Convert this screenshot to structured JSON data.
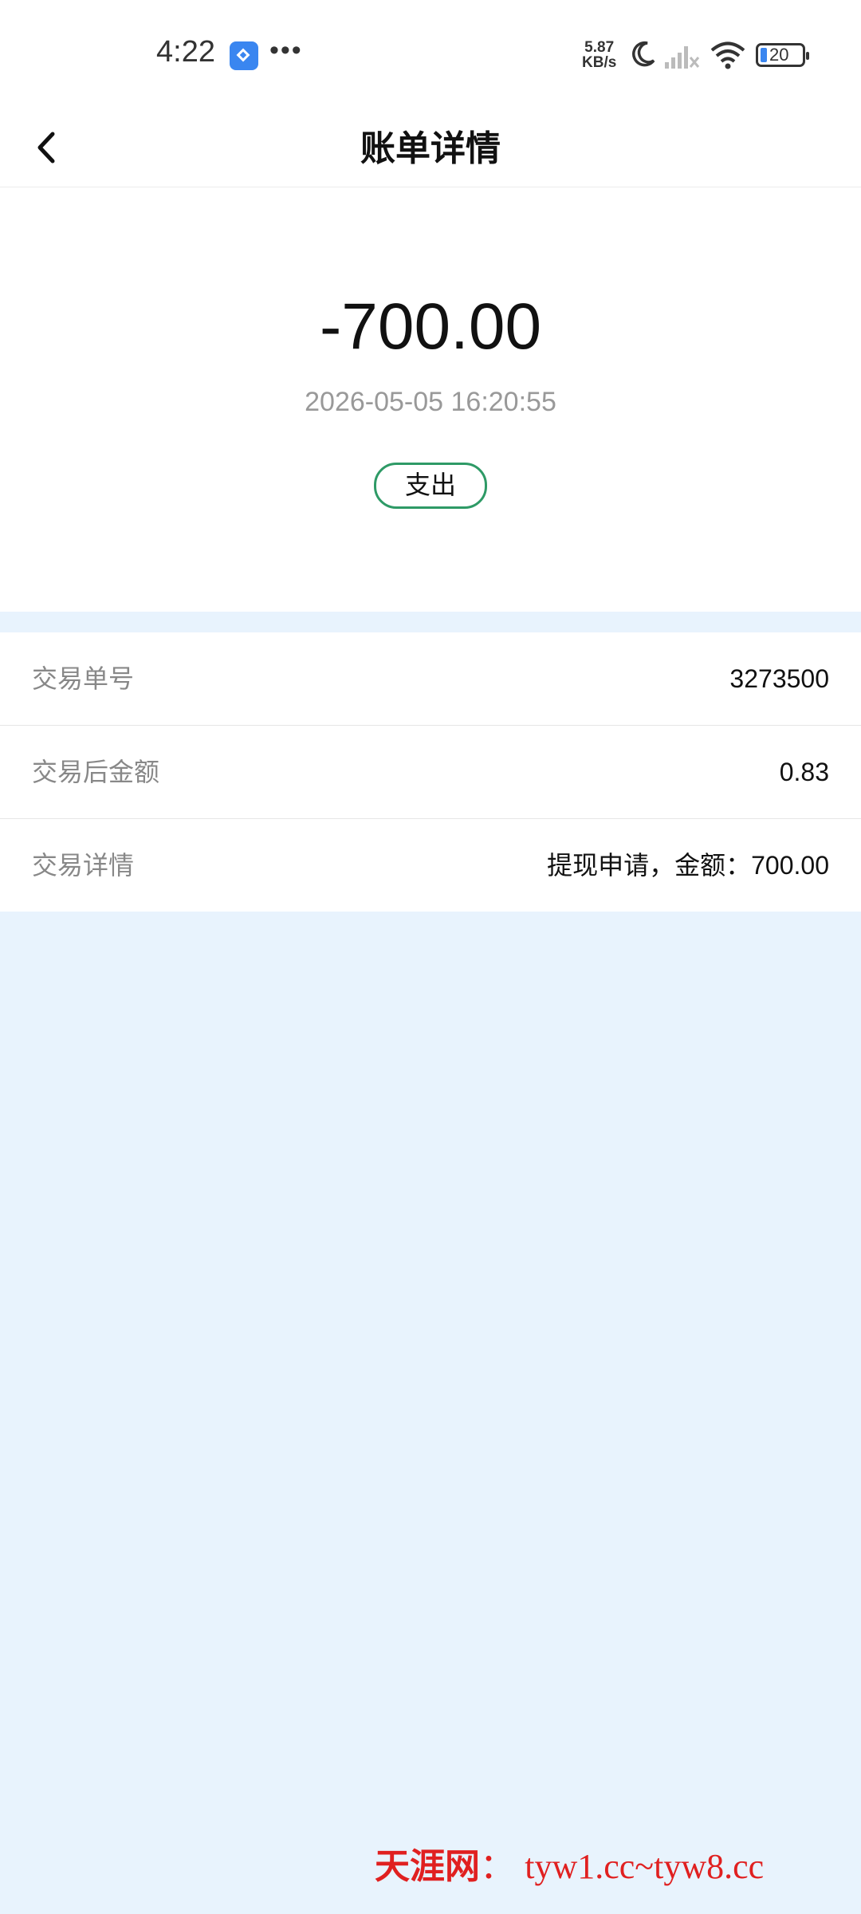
{
  "status_bar": {
    "time": "4:22",
    "dots": "•••",
    "net_speed_value": "5.87",
    "net_speed_unit": "KB/s",
    "battery": "20",
    "icons": [
      "app-shortcut-icon",
      "moon-icon",
      "signal-icon",
      "wifi-icon",
      "battery-icon"
    ]
  },
  "header": {
    "title": "账单详情",
    "back_icon": "chevron-left-icon"
  },
  "summary": {
    "amount": "-700.00",
    "datetime": "2026-05-05 16:20:55",
    "type_badge": "支出",
    "badge_color": "#2e9a66"
  },
  "details": [
    {
      "label": "交易单号",
      "value": "3273500"
    },
    {
      "label": "交易后金额",
      "value": "0.83"
    },
    {
      "label": "交易详情",
      "value": "提现申请，金额：700.00"
    }
  ],
  "watermark": {
    "name": "天涯网",
    "separator": "：",
    "url": "tyw1.cc~tyw8.cc"
  },
  "colors": {
    "page_bg": "#e8f3fd",
    "accent_blue": "#3a86f0",
    "watermark_red": "#e02020"
  }
}
